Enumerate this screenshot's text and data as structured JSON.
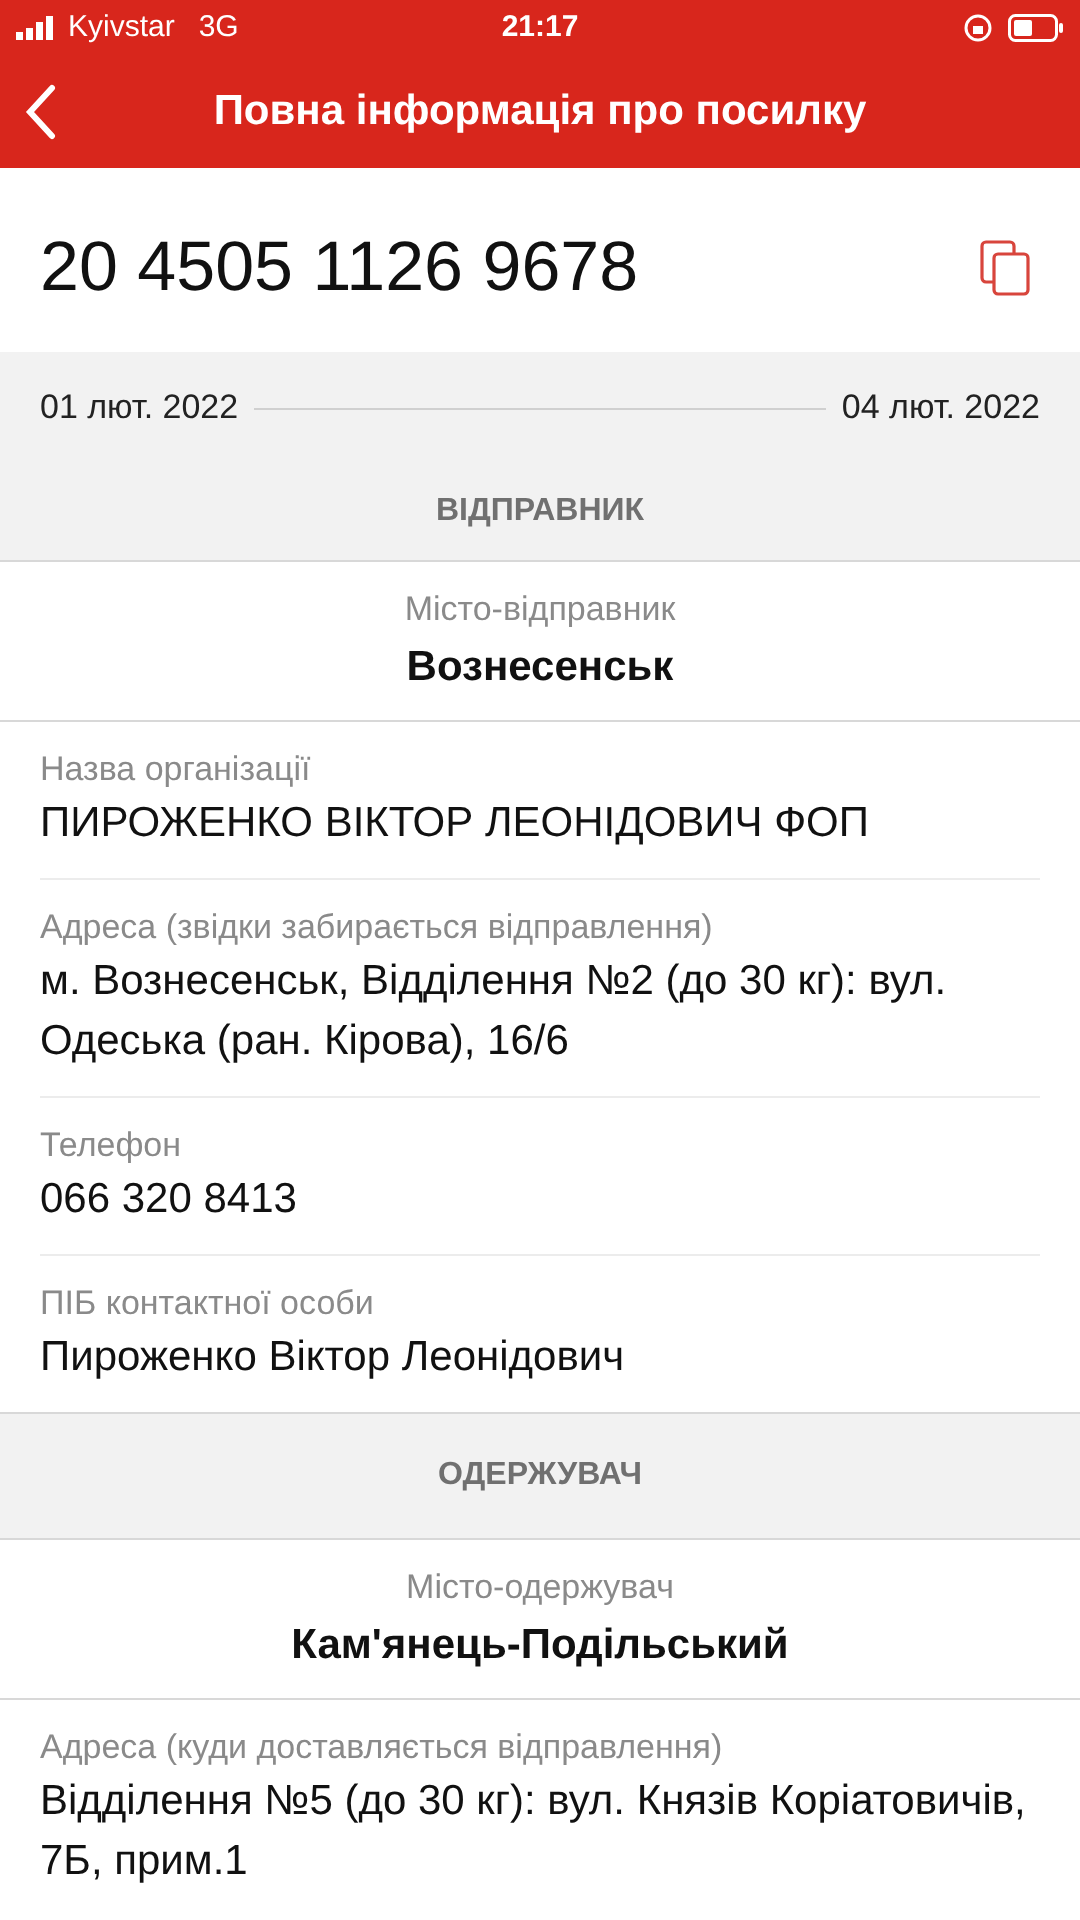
{
  "status_bar": {
    "carrier": "Kyivstar",
    "network": "3G",
    "time": "21:17"
  },
  "header": {
    "title": "Повна інформація про посилку"
  },
  "tracking_number": "20 4505 1126 9678",
  "dates": {
    "start": "01 лют. 2022",
    "end": "04 лют. 2022"
  },
  "sections": [
    {
      "title": "ВІДПРАВНИК",
      "city_label": "Місто-відправник",
      "city": "Вознесенськ",
      "fields": [
        {
          "label": "Назва організації",
          "value": "ПИРОЖЕНКО ВІКТОР ЛЕОНІДОВИЧ ФОП"
        },
        {
          "label": "Адреса (звідки забирається відправлення)",
          "value": "м. Вознесенськ, Відділення №2 (до 30 кг): вул. Одеська (ран. Кірова), 16/6"
        },
        {
          "label": "Телефон",
          "value": "066 320 8413"
        },
        {
          "label": "ПІБ контактної особи",
          "value": "Пироженко Віктор Леонідович"
        }
      ]
    },
    {
      "title": "ОДЕРЖУВАЧ",
      "city_label": "Місто-одержувач",
      "city": "Кам'янець-Подільський",
      "fields": [
        {
          "label": "Адреса (куди доставляється відправлення)",
          "value": "Відділення №5 (до 30 кг): вул. Князів Коріатовичів, 7Б, прим.1"
        }
      ]
    }
  ]
}
